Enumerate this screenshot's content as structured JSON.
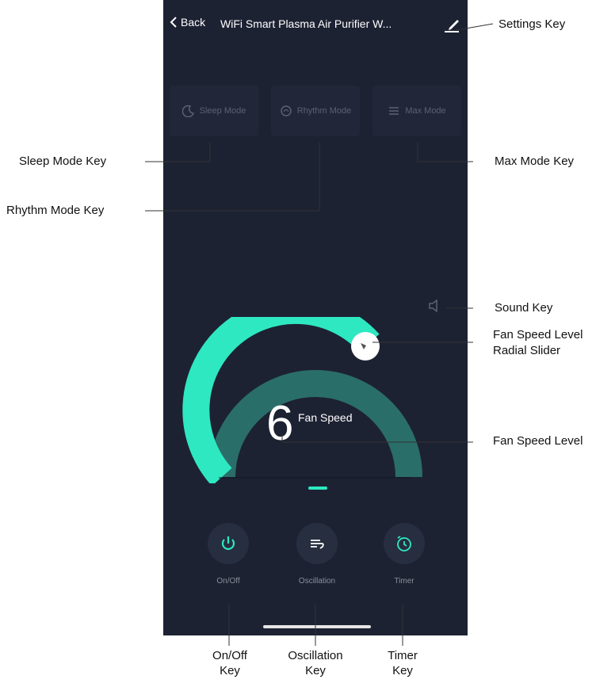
{
  "header": {
    "back_label": "Back",
    "title": "WiFi Smart Plasma Air Purifier W..."
  },
  "modes": [
    {
      "label": "Sleep Mode",
      "icon": "moon-icon"
    },
    {
      "label": "Rhythm Mode",
      "icon": "rhythm-icon"
    },
    {
      "label": "Max Mode",
      "icon": "max-icon"
    }
  ],
  "fan": {
    "level": "6",
    "label": "Fan Speed"
  },
  "controls": [
    {
      "label": "On/Off",
      "icon": "power-icon"
    },
    {
      "label": "Oscillation",
      "icon": "oscillation-icon"
    },
    {
      "label": "Timer",
      "icon": "timer-icon"
    }
  ],
  "annotations": {
    "settings": "Settings Key",
    "sleep": "Sleep Mode Key",
    "rhythm": "Rhythm Mode Key",
    "max": "Max Mode Key",
    "sound": "Sound Key",
    "slider_line1": "Fan Speed Level",
    "slider_line2": "Radial Slider",
    "fan_level": "Fan Speed Level",
    "onoff_line1": "On/Off",
    "onoff_line2": "Key",
    "osc_line1": "Oscillation",
    "osc_line2": "Key",
    "timer_line1": "Timer",
    "timer_line2": "Key"
  },
  "colors": {
    "background": "#1d2233",
    "accent": "#2ee8c1",
    "arc_track": "#2a6e6a",
    "text": "#ffffff"
  }
}
